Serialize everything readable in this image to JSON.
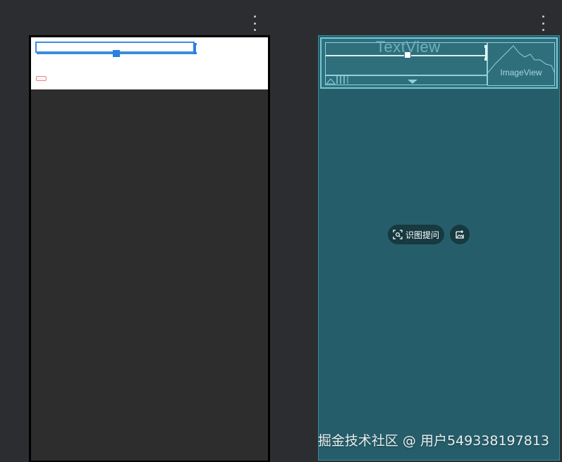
{
  "canvas": {
    "background": "#2b2d30",
    "left_panel_options_icon": "more-vertical-icon",
    "right_panel_options_icon": "more-vertical-icon"
  },
  "design_view": {
    "header_background": "#ffffff",
    "selection_color": "#3b8ddd",
    "screen_background": "#2d2d2d"
  },
  "blueprint_view": {
    "background": "#255e6a",
    "outline_color": "#78c7d6",
    "textview_label": "TextView",
    "imageview_label": "ImageView"
  },
  "overlay": {
    "recognize_button_label": "识图提问",
    "recognize_icon": "scan-image-icon",
    "image_action_icon": "image-edit-icon"
  },
  "watermark": {
    "text": "掘金技术社区 @ 用户549338197813"
  }
}
